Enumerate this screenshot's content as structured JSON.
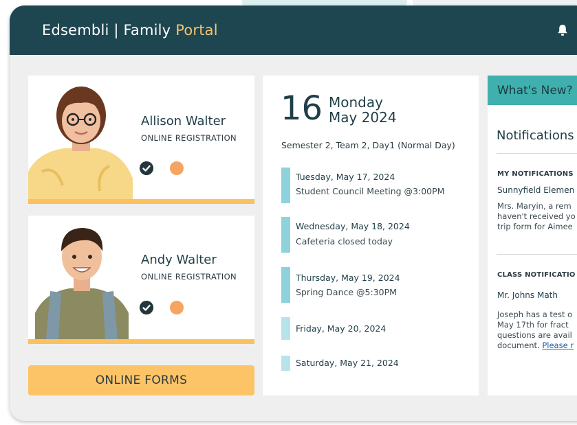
{
  "header": {
    "title_main": "Edsembli | Family ",
    "title_accent": "Portal"
  },
  "students": [
    {
      "name": "Allison Walter",
      "registration": "ONLINE REGISTRATION"
    },
    {
      "name": "Andy Walter",
      "registration": "ONLINE REGISTRATION"
    }
  ],
  "forms_button": "ONLINE FORMS",
  "calendar": {
    "day_number": "16",
    "day_name": "Monday",
    "month_year": "May 2024",
    "semester": "Semester 2, Team 2, Day1 (Normal Day)",
    "events": [
      {
        "date": "Tuesday, May 17, 2024",
        "description": "Student Council Meeting @3:00PM"
      },
      {
        "date": "Wednesday, May 18, 2024",
        "description": "Cafeteria closed today"
      },
      {
        "date": "Thursday, May 19, 2024",
        "description": "Spring Dance @5:30PM"
      },
      {
        "date": "Friday, May 20, 2024",
        "description": ""
      },
      {
        "date": "Saturday, May 21, 2024",
        "description": ""
      }
    ]
  },
  "news": {
    "banner": "What's New?",
    "notifications_title": "Notifications",
    "my_notifications": {
      "heading": "MY NOTIFICATIONS",
      "from": "Sunnyfield Elemen",
      "lines": [
        "Mrs. Maryin, a rem",
        "haven't received yo",
        "trip form for Aimee"
      ]
    },
    "class_notifications": {
      "heading": "CLASS NOTIFICATIO",
      "from": "Mr. Johns Math",
      "lines": [
        "Joseph has a test o",
        "May 17th for fract",
        "questions are avail"
      ],
      "last_line_prefix": "document. ",
      "link": "Please r"
    }
  }
}
